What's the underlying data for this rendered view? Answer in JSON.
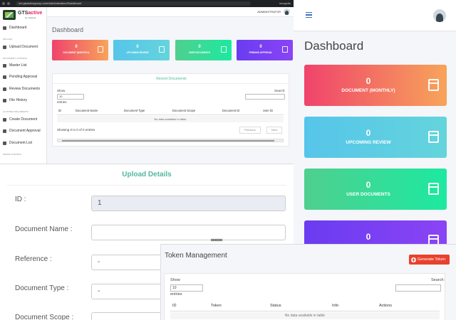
{
  "desktop": {
    "browser_url": "uni.gtsactivegroup.com/Administration/Dashboard",
    "browser_incognito": "Incognito",
    "logo_main": "GTS",
    "logo_accent": "active",
    "logo_sub": "by mvdevel",
    "admin_label": "ADMINISTRATOR",
    "sidebar": {
      "dashboard": "Dashboard",
      "sec_upload": "UPLOAD",
      "upload": "Upload Document",
      "sec_control": "DOCUMENT CONTROL",
      "master": "Master List",
      "pending": "Pending Approval",
      "review": "Review Documents",
      "history": "File History",
      "sec_cluster": "CLUSTER DOCUMENTS",
      "create": "Create Document",
      "approval": "Document Approval",
      "list": "Document List",
      "sec_admin": "ADMIN CONTROL"
    },
    "title": "Dashboard",
    "cards": [
      {
        "value": "0",
        "label": "DOCUMENT (MONTHLY)"
      },
      {
        "value": "0",
        "label": "UPCOMING REVIEW"
      },
      {
        "value": "0",
        "label": "USER DOCUMENTS"
      },
      {
        "value": "0",
        "label": "PENDING APPROVAL"
      }
    ],
    "recent": {
      "title": "Recent Documents",
      "show": "Show",
      "entries_value": "10",
      "entries": "entries",
      "search": "Search:",
      "columns": [
        "ID",
        "Document Name",
        "Document Type",
        "Document Scope",
        "Document ID",
        "User ID"
      ],
      "empty": "No data available in table",
      "info": "Showing 0 to 0 of 0 entries",
      "prev": "Previous",
      "next": "Next"
    }
  },
  "mobile": {
    "title": "Dashboard",
    "cards": [
      {
        "value": "0",
        "label": "DOCUMENT (MONTHLY)"
      },
      {
        "value": "0",
        "label": "UPCOMING REVIEW"
      },
      {
        "value": "0",
        "label": "USER DOCUMENTS"
      },
      {
        "value": "0",
        "label": ""
      }
    ]
  },
  "upload": {
    "title": "Upload Details",
    "fields": [
      {
        "label": "ID :",
        "value": "1"
      },
      {
        "label": "Document Name :",
        "value": ""
      },
      {
        "label": "Reference :",
        "value": "-"
      },
      {
        "label": "Document Type :",
        "value": "-"
      },
      {
        "label": "Document Scope :",
        "value": ""
      }
    ]
  },
  "token": {
    "title": "Token Management",
    "generate": "Generate Token",
    "show": "Show",
    "entries_value": "10",
    "entries": "entries",
    "search": "Search:",
    "columns": [
      "ID",
      "Token",
      "Status",
      "Info",
      "Actions"
    ],
    "empty": "No data available in table"
  },
  "colors": {
    "accent": "#50b8a0",
    "card_red": "#f0436c",
    "card_blue": "#56c5ea",
    "card_green": "#4fcf8f",
    "card_purple": "#6a3cf0",
    "danger": "#e8412e"
  }
}
